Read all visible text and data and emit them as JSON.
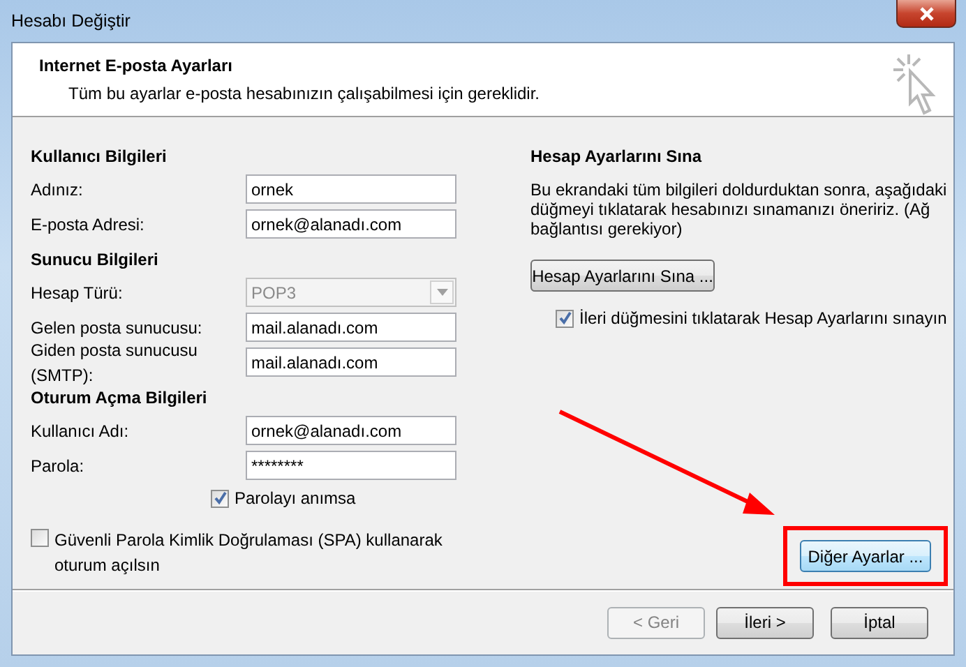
{
  "window": {
    "title": "Hesabı Değiştir"
  },
  "header": {
    "title": "Internet E-posta Ayarları",
    "subtitle": "Tüm bu ayarlar e-posta hesabınızın çalışabilmesi için gereklidir."
  },
  "sections": [
    {
      "title": "Kullanıcı Bilgileri",
      "fields": [
        {
          "kind": "text",
          "label": "Adınız:",
          "value": "ornek"
        },
        {
          "kind": "text",
          "label": "E-posta Adresi:",
          "value": "ornek@alanadı.com"
        }
      ]
    },
    {
      "title": "Sunucu Bilgileri",
      "fields": [
        {
          "kind": "select",
          "label": "Hesap Türü:",
          "value": "POP3",
          "disabled": true
        },
        {
          "kind": "text",
          "label": "Gelen posta sunucusu:",
          "value": "mail.alanadı.com"
        },
        {
          "kind": "text",
          "label": "Giden posta sunucusu (SMTP):",
          "value": "mail.alanadı.com"
        }
      ]
    },
    {
      "title": "Oturum Açma Bilgileri",
      "fields": [
        {
          "kind": "text",
          "label": "Kullanıcı Adı:",
          "value": "ornek@alanadı.com"
        },
        {
          "kind": "password",
          "label": "Parola:",
          "value": "********"
        }
      ]
    }
  ],
  "remember_password": {
    "label": "Parolayı anımsa",
    "checked": true
  },
  "spa": {
    "label": "Güvenli Parola Kimlik Doğrulaması (SPA) kullanarak oturum açılsın",
    "checked": false
  },
  "test": {
    "title": "Hesap Ayarlarını Sına",
    "description": "Bu ekrandaki tüm bilgileri doldurduktan sonra, aşağıdaki düğmeyi tıklatarak hesabınızı sınamanızı öneririz. (Ağ bağlantısı gerekiyor)",
    "button": "Hesap Ayarlarını Sına ...",
    "auto_test": {
      "label": "İleri düğmesini tıklatarak Hesap Ayarlarını sınayın",
      "checked": true
    }
  },
  "more_settings": {
    "label": "Diğer Ayarlar ...",
    "highlighted": true
  },
  "buttons": [
    {
      "label": "< Geri",
      "disabled": true
    },
    {
      "label": "İleri >",
      "disabled": false
    },
    {
      "label": "İptal",
      "disabled": false
    }
  ]
}
